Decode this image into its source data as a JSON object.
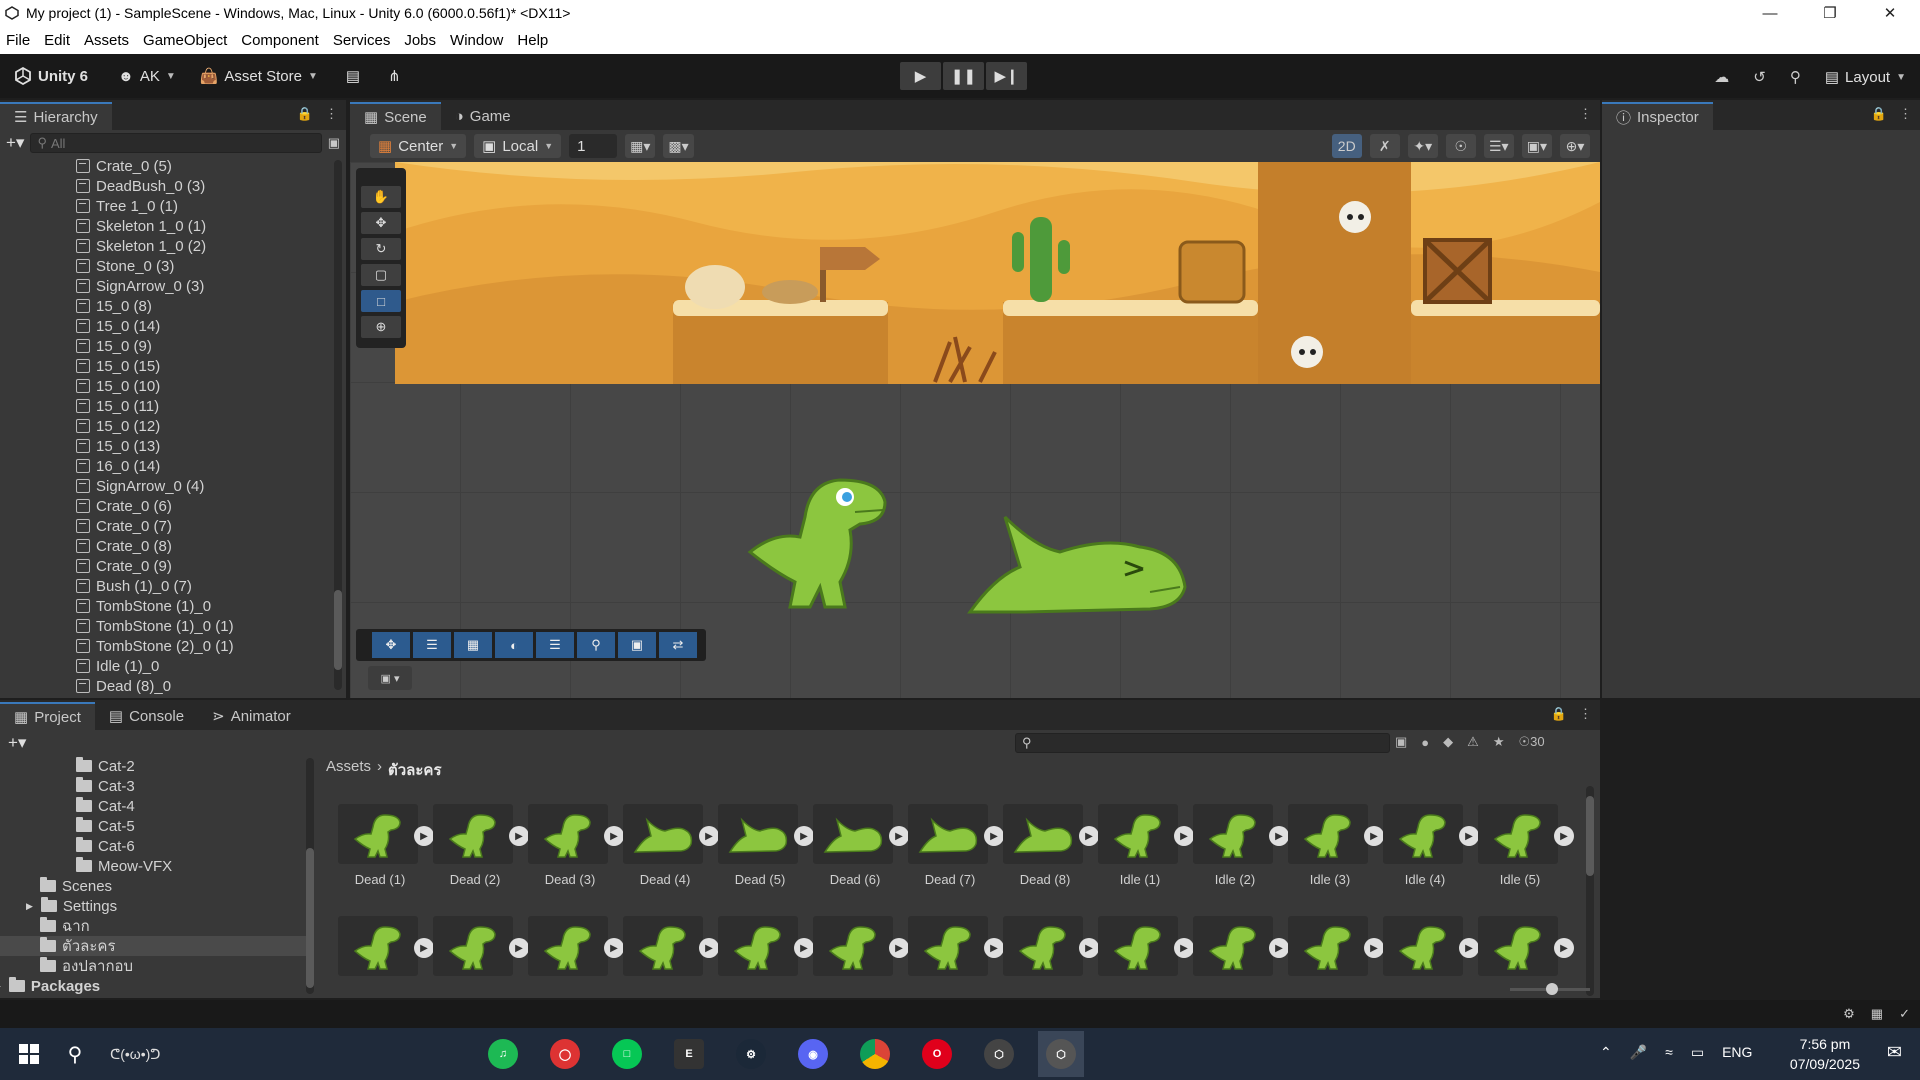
{
  "window": {
    "title": "My project (1) - SampleScene - Windows, Mac, Linux - Unity 6.0 (6000.0.56f1)* <DX11>"
  },
  "menu": [
    "File",
    "Edit",
    "Assets",
    "GameObject",
    "Component",
    "Services",
    "Jobs",
    "Window",
    "Help"
  ],
  "toolbar": {
    "unity_label": "Unity 6",
    "account": "AK",
    "asset_store": "Asset Store",
    "layout": "Layout"
  },
  "hierarchy": {
    "tab": "Hierarchy",
    "search_placeholder": "All",
    "items": [
      "Crate_0 (5)",
      "DeadBush_0 (3)",
      "Tree 1_0 (1)",
      "Skeleton 1_0 (1)",
      "Skeleton 1_0 (2)",
      "Stone_0 (3)",
      "SignArrow_0 (3)",
      "15_0 (8)",
      "15_0 (14)",
      "15_0 (9)",
      "15_0 (15)",
      "15_0 (10)",
      "15_0 (11)",
      "15_0 (12)",
      "15_0 (13)",
      "16_0 (14)",
      "SignArrow_0 (4)",
      "Crate_0 (6)",
      "Crate_0 (7)",
      "Crate_0 (8)",
      "Crate_0 (9)",
      "Bush (1)_0 (7)",
      "TombStone (1)_0",
      "TombStone (1)_0 (1)",
      "TombStone (2)_0 (1)",
      "Idle (1)_0",
      "Dead (8)_0"
    ]
  },
  "scene": {
    "tabs": [
      "Scene",
      "Game"
    ],
    "pivot": "Center",
    "space": "Local",
    "grid_value": "1",
    "mode_2d": "2D"
  },
  "inspector": {
    "tab": "Inspector"
  },
  "project": {
    "tabs": [
      "Project",
      "Console",
      "Animator"
    ],
    "tree": [
      {
        "label": "Cat-2",
        "indent": 3
      },
      {
        "label": "Cat-3",
        "indent": 3
      },
      {
        "label": "Cat-4",
        "indent": 3
      },
      {
        "label": "Cat-5",
        "indent": 3
      },
      {
        "label": "Cat-6",
        "indent": 3
      },
      {
        "label": "Meow-VFX",
        "indent": 3
      },
      {
        "label": "Scenes",
        "indent": 2
      },
      {
        "label": "Settings",
        "indent": 2
      },
      {
        "label": "ฉาก",
        "indent": 2
      },
      {
        "label": "ตัวละคร",
        "indent": 2
      },
      {
        "label": "องปลากอบ",
        "indent": 2
      },
      {
        "label": "Packages",
        "indent": 0
      }
    ],
    "breadcrumb_root": "Assets",
    "breadcrumb_current": "ตัวละคร",
    "visible_count": "30",
    "assets_row1": [
      "Dead (1)",
      "Dead (2)",
      "Dead (3)",
      "Dead (4)",
      "Dead (5)",
      "Dead (6)",
      "Dead (7)",
      "Dead (8)",
      "Idle (1)",
      "Idle (2)",
      "Idle (3)",
      "Idle (4)",
      "Idle (5)"
    ]
  },
  "taskbar": {
    "search_text": "ᕦ(•ω•)ᕤ",
    "lang": "ENG",
    "time": "7:56 pm",
    "date": "07/09/2025"
  },
  "colors": {
    "accent": "#3a79bb",
    "dino": "#8cc63f",
    "desert": "#f0b34a"
  }
}
